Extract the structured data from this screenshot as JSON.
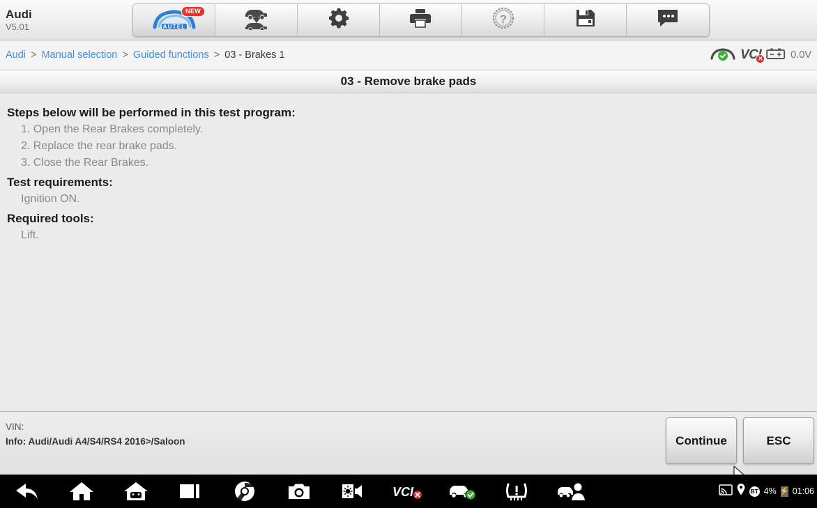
{
  "brand": {
    "name": "Audi",
    "version": "V5.01"
  },
  "toolbar": {
    "buttons": [
      {
        "name": "autel-home-button",
        "icon": "autel-logo-icon",
        "badge": "NEW"
      },
      {
        "name": "vehicle-swap-button",
        "icon": "vehicle-swap-icon",
        "badge": ""
      },
      {
        "name": "settings-button",
        "icon": "gear-icon",
        "badge": ""
      },
      {
        "name": "print-button",
        "icon": "printer-icon",
        "badge": ""
      },
      {
        "name": "help-button",
        "icon": "question-mark-icon",
        "badge": ""
      },
      {
        "name": "save-button",
        "icon": "floppy-disk-icon",
        "badge": ""
      },
      {
        "name": "feedback-button",
        "icon": "chat-bubble-icon",
        "badge": ""
      }
    ]
  },
  "breadcrumb": {
    "links": [
      "Audi",
      "Manual selection",
      "Guided functions"
    ],
    "separator": ">",
    "current": "03 - Brakes 1"
  },
  "status": {
    "connection_icon": "vehicle-connected-icon",
    "vci_label": "VCI",
    "vci_state": "disconnected",
    "battery_icon": "battery-icon",
    "voltage": "0.0V"
  },
  "page_title": "03 - Remove brake pads",
  "main": {
    "blocks": [
      {
        "heading": "Steps below will be performed in this test program:",
        "lines": [
          "1. Open the Rear Brakes completely.",
          "2. Replace the rear brake pads.",
          "3. Close the Rear Brakes."
        ]
      },
      {
        "heading": "Test requirements:",
        "lines": [
          "Ignition ON."
        ]
      },
      {
        "heading": "Required tools:",
        "lines": [
          "Lift."
        ]
      }
    ]
  },
  "footer": {
    "vin_label": "VIN:",
    "vin_value": "",
    "info_label": "Info:",
    "info_value": "Audi/Audi A4/S4/RS4 2016>/Saloon",
    "continue_label": "Continue",
    "esc_label": "ESC"
  },
  "navbar": {
    "icons": [
      "back-arrow-icon",
      "home-icon",
      "android-home-icon",
      "recent-apps-icon",
      "chrome-browser-icon",
      "camera-icon",
      "brightness-volume-icon",
      "vci-status-icon",
      "vehicle-status-icon",
      "tpms-warning-icon",
      "remote-assist-icon"
    ],
    "tray": {
      "cast_icon": "cast-icon",
      "location_icon": "location-pin-icon",
      "bluetooth_label": "BT",
      "battery_percent": "4%",
      "charging_icon": "charging-bolt-icon",
      "time": "01:06"
    }
  },
  "colors": {
    "link": "#3b8ee8",
    "badge_red": "#e8342a",
    "status_green": "#3cb034",
    "status_red": "#dd2b2b",
    "muted_text": "#888888"
  }
}
